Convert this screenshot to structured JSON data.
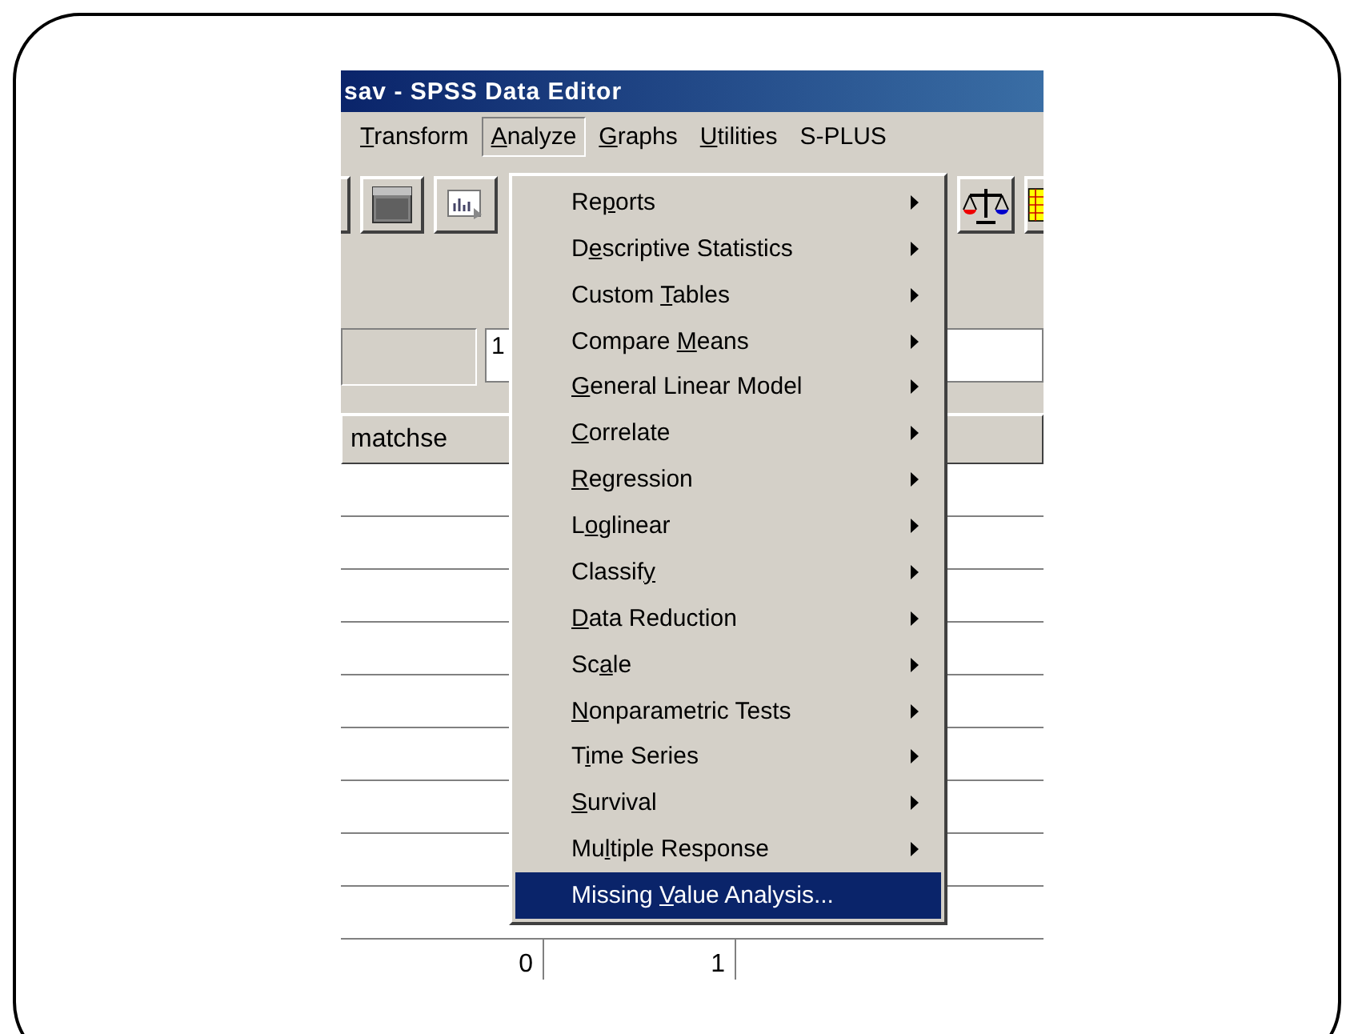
{
  "window": {
    "title": "sav - SPSS Data Editor"
  },
  "menubar": [
    {
      "label": {
        "key": "T",
        "post": "ransform"
      },
      "selected": false
    },
    {
      "label": {
        "key": "A",
        "post": "nalyze"
      },
      "selected": true
    },
    {
      "label": {
        "key": "G",
        "post": "raphs"
      },
      "selected": false
    },
    {
      "label": {
        "key": "U",
        "post": "tilities"
      },
      "selected": false
    },
    {
      "label": {
        "pre": "S-PLUS"
      },
      "selected": false
    }
  ],
  "cell_editor": {
    "value": "1"
  },
  "grid": {
    "header": [
      "matchse"
    ],
    "rows": [
      [
        "0",
        "1"
      ]
    ]
  },
  "menu": [
    {
      "label": {
        "pre": "Re",
        "key": "p",
        "post": "orts"
      },
      "submenu": true,
      "selected": false
    },
    {
      "label": {
        "pre": "D",
        "key": "e",
        "post": "scriptive Statistics"
      },
      "submenu": true,
      "selected": false
    },
    {
      "label": {
        "pre": "Custom ",
        "key": "T",
        "post": "ables"
      },
      "submenu": true,
      "selected": false
    },
    {
      "label": {
        "pre": "Compare ",
        "key": "M",
        "post": "eans"
      },
      "submenu": true,
      "selected": false
    },
    {
      "label": {
        "key": "G",
        "post": "eneral Linear Model"
      },
      "submenu": true,
      "selected": false
    },
    {
      "label": {
        "key": "C",
        "post": "orrelate"
      },
      "submenu": true,
      "selected": false
    },
    {
      "label": {
        "key": "R",
        "post": "egression"
      },
      "submenu": true,
      "selected": false
    },
    {
      "label": {
        "pre": "L",
        "key": "o",
        "post": "glinear"
      },
      "submenu": true,
      "selected": false
    },
    {
      "label": {
        "pre": "Classif",
        "key": "y"
      },
      "submenu": true,
      "selected": false
    },
    {
      "label": {
        "key": "D",
        "post": "ata Reduction"
      },
      "submenu": true,
      "selected": false
    },
    {
      "label": {
        "pre": "Sc",
        "key": "a",
        "post": "le"
      },
      "submenu": true,
      "selected": false
    },
    {
      "label": {
        "key": "N",
        "post": "onparametric Tests"
      },
      "submenu": true,
      "selected": false
    },
    {
      "label": {
        "pre": "T",
        "key": "i",
        "post": "me Series"
      },
      "submenu": true,
      "selected": false
    },
    {
      "label": {
        "key": "S",
        "post": "urvival"
      },
      "submenu": true,
      "selected": false
    },
    {
      "label": {
        "pre": "Mu",
        "key": "l",
        "post": "tiple Response"
      },
      "submenu": true,
      "selected": false
    },
    {
      "label": {
        "pre": "Missing ",
        "key": "V",
        "post": "alue Analysis..."
      },
      "submenu": false,
      "selected": true
    }
  ]
}
